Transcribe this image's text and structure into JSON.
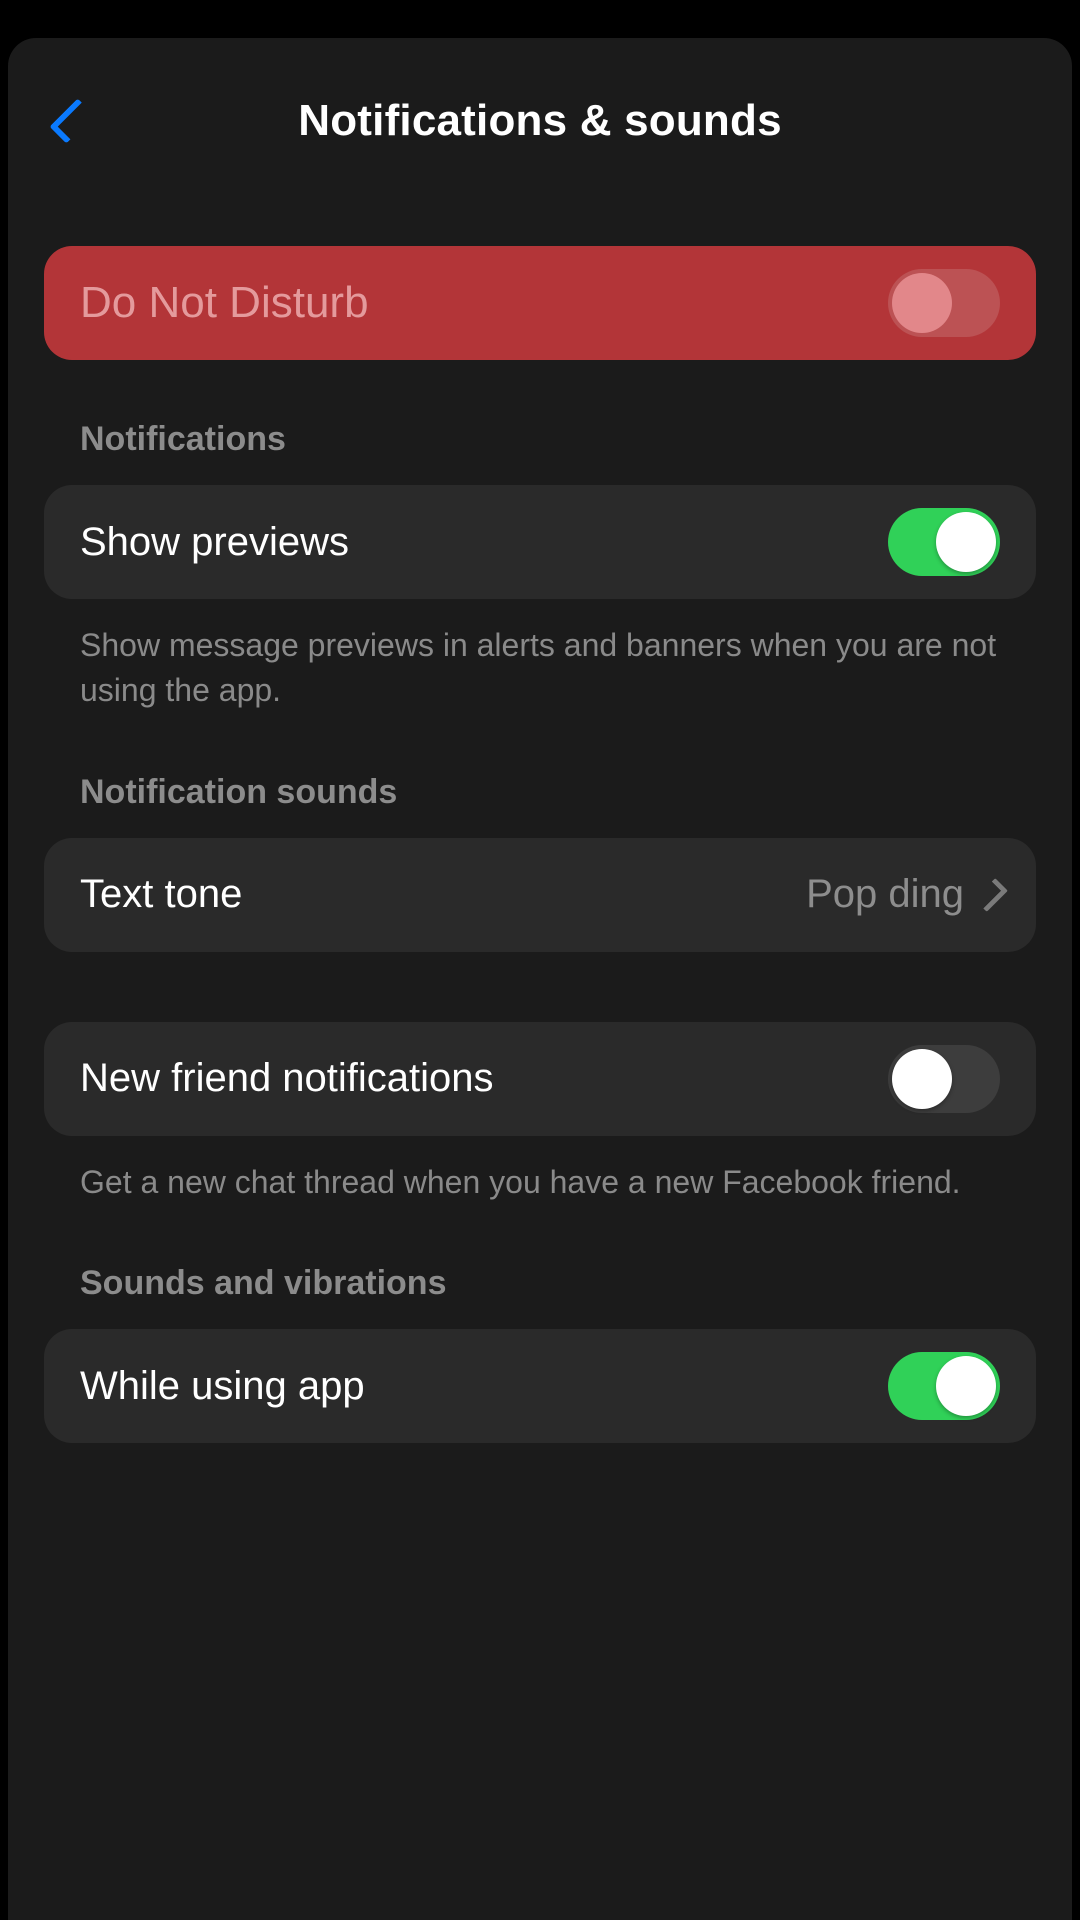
{
  "header": {
    "title": "Notifications & sounds"
  },
  "dnd": {
    "label": "Do Not Disturb",
    "on": false
  },
  "sections": {
    "notifications": {
      "heading": "Notifications",
      "show_previews_label": "Show previews",
      "show_previews_on": true,
      "desc": "Show message previews in alerts and banners when you are not using the app."
    },
    "sounds": {
      "heading": "Notification sounds",
      "text_tone_label": "Text tone",
      "text_tone_value": "Pop ding"
    },
    "friends": {
      "new_friend_label": "New friend notifications",
      "new_friend_on": false,
      "desc": "Get a new chat thread when you have a new Facebook friend."
    },
    "vibrations": {
      "heading": "Sounds and vibrations",
      "while_using_label": "While using app",
      "while_using_on": true
    }
  }
}
